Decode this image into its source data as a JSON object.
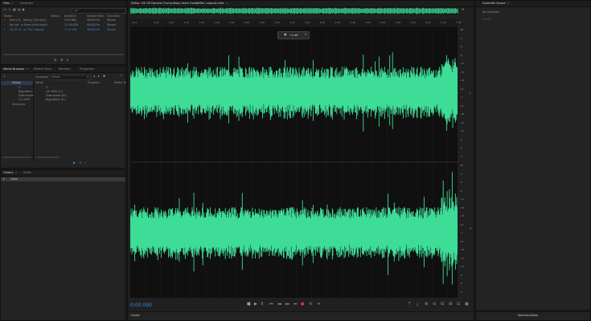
{
  "files_panel": {
    "tabs": [
      "Files",
      "Favorites"
    ],
    "search_placeholder": "ρ∙",
    "columns": [
      "Name",
      "Status",
      "Duration",
      "Sample Rate",
      "Channels"
    ],
    "rows": [
      {
        "name": "Jenny R... Acting (Tyo.mp4)",
        "duration": "3:55.880",
        "rate": "48000 Hz",
        "channels": "Stereo"
      },
      {
        "name": "Jon Val...e Show (Intlu.mp4)",
        "duration": "11:34.876",
        "rate": "44100 Hz",
        "channels": "Stereo"
      },
      {
        "name": "UK OS D...ks The Lawsuit",
        "duration": "7:14.796",
        "rate": "48000 Hz",
        "channels": "Stereo"
      }
    ]
  },
  "media_browser": {
    "tabs": [
      "Media Browser",
      "Effects Rack",
      "Markers",
      "Properties"
    ],
    "contents_label": "Contents:",
    "contents_value": "Drives",
    "tree": [
      "Drives",
      "C:",
      "Bigpatters",
      "Downloads",
      "LD 4090"
    ],
    "shortcuts": "Shortcuts",
    "list_headers": [
      "Name",
      "Duration",
      "Media Ty"
    ],
    "list_items": [
      "C:",
      "LD 4090 (C:)",
      "Downloads (D:)",
      "Bigpatters (E:)"
    ]
  },
  "history_panel": {
    "tabs": [
      "History",
      "Video"
    ],
    "items": [
      "Open"
    ]
  },
  "editor": {
    "tab_title": "Editor: UK OS Daniels Trump Baby Voice Grabs The Lawsuit.m4a",
    "mixer_tab": "Mixer",
    "hud_value": "+0 dB",
    "time": "0:00.000",
    "ruler": [
      "hms",
      "0:20",
      "0:40",
      "1:00",
      "1:20",
      "1:40",
      "2:00",
      "2:20",
      "2:40",
      "3:00",
      "3:20",
      "3:40",
      "4:00",
      "4:20",
      "4:40",
      "5:00",
      "5:20",
      "5:40",
      "6:00",
      "6:20",
      "6:40",
      "7:00"
    ],
    "db_scale_top": [
      "dB",
      "-3",
      "-6",
      "-9",
      "-12",
      "-15",
      "-18",
      "-21",
      "-∞",
      "-21",
      "-18",
      "-15",
      "-12",
      "-9",
      "-6",
      "-3"
    ],
    "db_scale_bottom": [
      "dB",
      "-3",
      "-6",
      "-9",
      "-12",
      "-15",
      "-18",
      "-21",
      "-∞",
      "-21",
      "-18",
      "-15",
      "-12",
      "-9",
      "-6",
      "-3"
    ],
    "channel_labels": [
      "L",
      "R"
    ],
    "wave_color": "#3ddc97"
  },
  "essential_sound": {
    "title": "Essential Sound",
    "no_selection": "No Selection",
    "preset": "Preset"
  },
  "levels": {
    "title": "Levels"
  },
  "selection_view": {
    "title": "Selection/View"
  }
}
